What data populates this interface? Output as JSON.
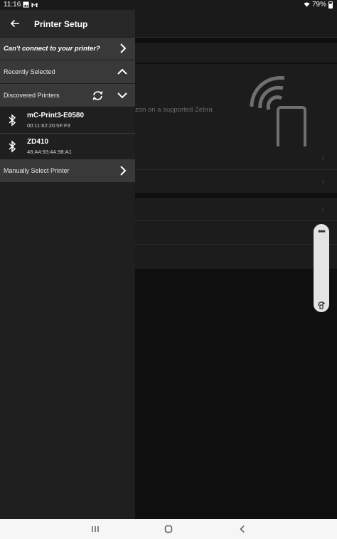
{
  "status_bar": {
    "time": "11:16",
    "battery": "79%",
    "icons": [
      "image-icon",
      "gmail-icon",
      "wifi-icon",
      "battery-icon"
    ]
  },
  "background": {
    "partial_text": "zon on a supported Zebra"
  },
  "drawer": {
    "title": "Printer Setup",
    "cant_connect": "Can't connect to your printer?",
    "recently_selected": "Recently Selected",
    "discovered_printers": "Discovered Printers",
    "printers": [
      {
        "name": "mC-Print3-E0580",
        "mac": "00:11:62:20:5F:F3"
      },
      {
        "name": "ZD410",
        "mac": "48:A4:93:4A:98:A1"
      }
    ],
    "manual_select": "Manually Select Printer"
  },
  "colors": {
    "drawer_bg": "#1f1f1f",
    "row_bg": "#393939",
    "header_bg": "#282828",
    "navbar_bg": "#f6f6f6"
  }
}
